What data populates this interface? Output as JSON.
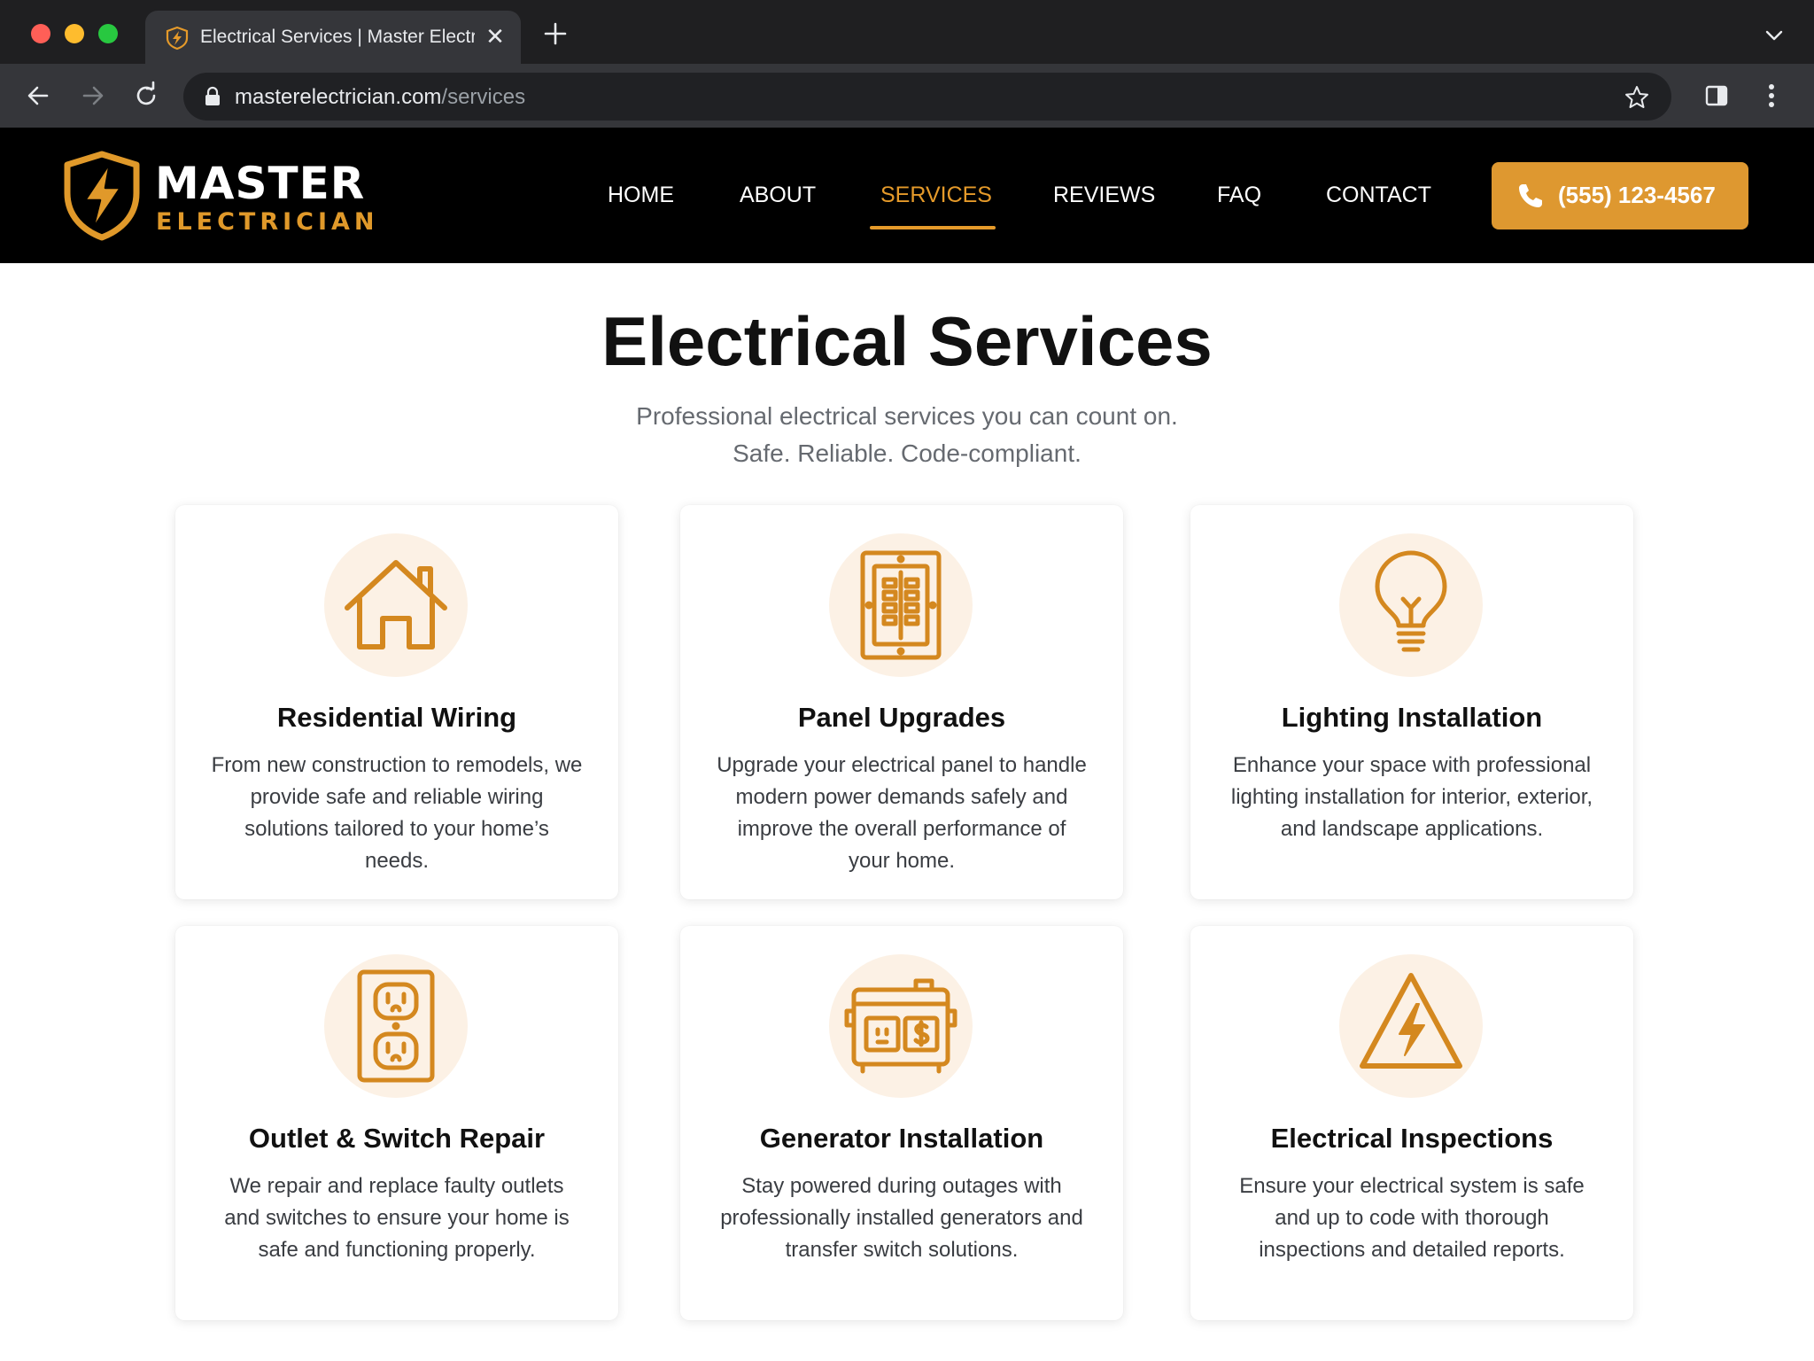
{
  "browser": {
    "tab": {
      "title": "Electrical Services | Master Electrician"
    },
    "url": {
      "domain": "masterelectrician.com",
      "path": "/services"
    }
  },
  "site": {
    "logo": {
      "top": "MASTER",
      "bottom": "ELECTRICIAN"
    },
    "nav": [
      "HOME",
      "ABOUT",
      "SERVICES",
      "REVIEWS",
      "FAQ",
      "CONTACT"
    ],
    "active_nav": "SERVICES",
    "phone": "(555) 123-4567",
    "colors": {
      "accent": "#e59a2a",
      "header_bg": "#000000",
      "icon_bg": "#fcf1e5"
    }
  },
  "main": {
    "title": "Electrical Services",
    "subtitle_line1": "Professional electrical services you can count on.",
    "subtitle_line2": "Safe. Reliable. Code-compliant.",
    "services": [
      {
        "icon": "house-icon",
        "title": "Residential Wiring",
        "description": "From new construction to remodels, we provide safe and reliable wiring solutions tailored to your home’s needs."
      },
      {
        "icon": "electrical-panel-icon",
        "title": "Panel Upgrades",
        "description": "Upgrade your electrical panel to handle modern power demands safely and improve the overall performance of your home."
      },
      {
        "icon": "light-bulb-icon",
        "title": "Lighting Installation",
        "description": "Enhance your space with professional lighting installation for interior, exterior, and landscape applications."
      },
      {
        "icon": "outlet-icon",
        "title": "Outlet & Switch Repair",
        "description": "We repair and replace faulty outlets and switches to ensure your home is safe and functioning properly."
      },
      {
        "icon": "generator-icon",
        "title": "Generator Installation",
        "description": "Stay powered during outages with professionally installed generators and transfer switch solutions."
      },
      {
        "icon": "warning-bolt-icon",
        "title": "Electrical Inspections",
        "description": "Ensure your electrical system is safe and up to code with thorough inspections and detailed reports."
      }
    ]
  }
}
